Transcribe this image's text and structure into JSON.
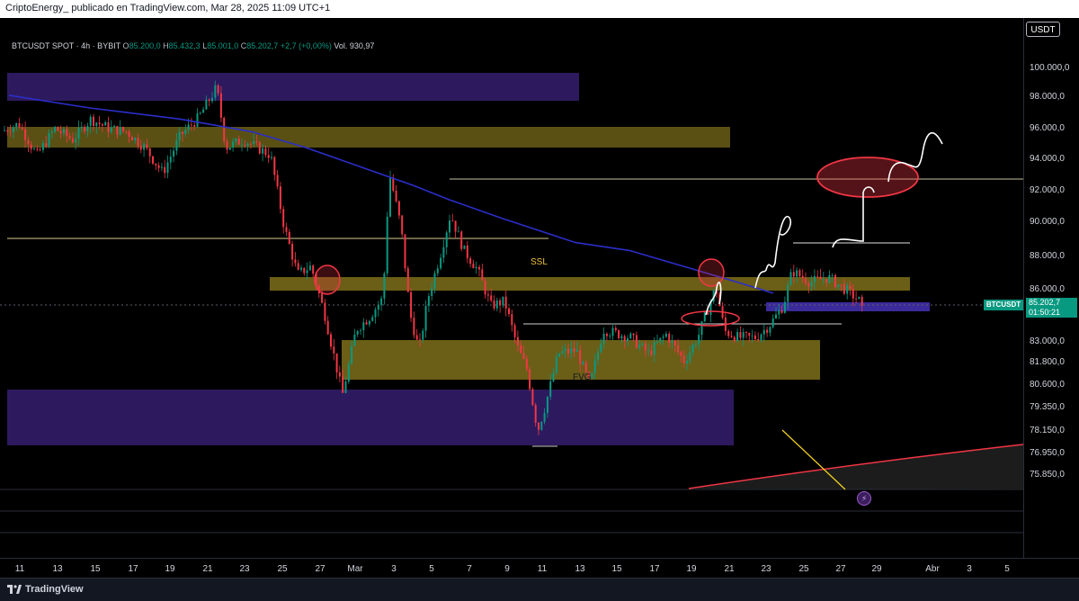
{
  "header": {
    "text": "CriptoEnergy_ publicado en TradingView.com, Mar 28, 2025 11:09 UTC+1"
  },
  "legend": {
    "symbol": "BTCUSDT SPOT · 4h · BYBIT",
    "open_label": "O",
    "open": "85.200,0",
    "high_label": "H",
    "high": "85.432,3",
    "low_label": "L",
    "low": "85.001,0",
    "close_label": "C",
    "close": "85.202,7",
    "change": "+2,7 (+0,00%)",
    "volume": "Vol. 930,97"
  },
  "currency": "USDT",
  "price_tag": {
    "symbol": "BTCUSDT",
    "price": "85.202,7",
    "countdown": "01:50:21"
  },
  "chart_labels": {
    "ssl": "SSL",
    "fvg": "FVG"
  },
  "alert_icon": "lightning-alert-icon",
  "footer": {
    "brand": "TradingView"
  },
  "colors": {
    "up": "#089981",
    "down": "#f23645",
    "ma": "#2b2ec9",
    "zone_yellow": "#5a5014",
    "zone_purple": "#2d1a5e",
    "background": "#000000"
  },
  "chart_data": {
    "type": "candlestick",
    "ylim": [
      75200,
      101000
    ],
    "y_ticks": [
      "100.000,0",
      "98.000,0",
      "96.000,0",
      "94.000,0",
      "92.000,0",
      "90.000,0",
      "88.000,0",
      "86.000,0",
      "83.000,0",
      "81.800,0",
      "80.600,0",
      "79.350,0",
      "78.150,0",
      "76.950,0",
      "75.850,0"
    ],
    "x_ticks": [
      "11",
      "13",
      "15",
      "17",
      "19",
      "21",
      "23",
      "25",
      "27",
      "Mar",
      "3",
      "5",
      "7",
      "9",
      "11",
      "13",
      "15",
      "17",
      "19",
      "21",
      "23",
      "25",
      "27",
      "29",
      "Abr",
      "3",
      "5"
    ],
    "path": [
      [
        0,
        97000
      ],
      [
        20,
        97500
      ],
      [
        40,
        95500
      ],
      [
        60,
        97200
      ],
      [
        80,
        96500
      ],
      [
        100,
        97800
      ],
      [
        120,
        97200
      ],
      [
        140,
        97000
      ],
      [
        160,
        96000
      ],
      [
        180,
        94400
      ],
      [
        200,
        96800
      ],
      [
        220,
        97900
      ],
      [
        240,
        99800
      ],
      [
        250,
        96000
      ],
      [
        270,
        96500
      ],
      [
        300,
        95500
      ],
      [
        315,
        91000
      ],
      [
        330,
        88000
      ],
      [
        345,
        88500
      ],
      [
        360,
        85500
      ],
      [
        380,
        80400
      ],
      [
        395,
        84500
      ],
      [
        410,
        85300
      ],
      [
        425,
        86500
      ],
      [
        432,
        94400
      ],
      [
        445,
        91000
      ],
      [
        455,
        85500
      ],
      [
        465,
        83200
      ],
      [
        475,
        86500
      ],
      [
        490,
        89500
      ],
      [
        500,
        91800
      ],
      [
        515,
        89500
      ],
      [
        530,
        88300
      ],
      [
        545,
        86000
      ],
      [
        560,
        86300
      ],
      [
        575,
        83300
      ],
      [
        585,
        82000
      ],
      [
        597,
        78100
      ],
      [
        605,
        79600
      ],
      [
        620,
        83000
      ],
      [
        640,
        83200
      ],
      [
        655,
        81000
      ],
      [
        670,
        84500
      ],
      [
        700,
        84000
      ],
      [
        720,
        83000
      ],
      [
        740,
        84200
      ],
      [
        760,
        82500
      ],
      [
        775,
        84000
      ],
      [
        785,
        85600
      ],
      [
        795,
        87200
      ],
      [
        805,
        84400
      ],
      [
        820,
        84000
      ],
      [
        840,
        84000
      ],
      [
        855,
        84800
      ],
      [
        870,
        86000
      ],
      [
        880,
        88200
      ],
      [
        900,
        87500
      ],
      [
        920,
        87800
      ],
      [
        940,
        87000
      ],
      [
        955,
        86300
      ],
      [
        960,
        85200
      ]
    ],
    "ma_path": [
      [
        10,
        99300
      ],
      [
        100,
        98500
      ],
      [
        200,
        97800
      ],
      [
        280,
        97000
      ],
      [
        340,
        96000
      ],
      [
        400,
        94800
      ],
      [
        460,
        93600
      ],
      [
        500,
        92700
      ],
      [
        560,
        91500
      ],
      [
        640,
        90000
      ],
      [
        700,
        89500
      ],
      [
        760,
        88500
      ],
      [
        820,
        87500
      ],
      [
        860,
        86800
      ]
    ]
  }
}
